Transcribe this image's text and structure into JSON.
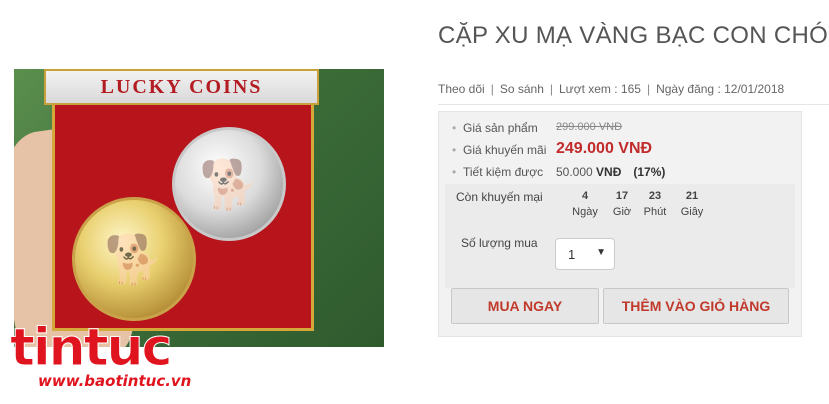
{
  "photo": {
    "lid_text": "LUCKY COINS"
  },
  "watermark": {
    "logo": "tintuc",
    "url": "www.baotintuc.vn"
  },
  "product": {
    "title": "CẶP XU MẠ VÀNG BẠC CON CHÓ V",
    "meta": {
      "follow": "Theo dõi",
      "compare": "So sánh",
      "views": "Lượt xem : 165",
      "posted": "Ngày đăng : 12/01/2018"
    }
  },
  "pricing": {
    "original_label": "Giá sản phẩm",
    "original_value": "299.000 VNĐ",
    "sale_label": "Giá khuyến mãi",
    "sale_value": "249.000 VNĐ",
    "save_label": "Tiết kiệm được",
    "save_amount": "50.000",
    "save_currency": "VNĐ",
    "save_percent": "(17%)"
  },
  "countdown": {
    "label": "Còn khuyến mại",
    "units": [
      {
        "value": "4",
        "unit": "Ngày"
      },
      {
        "value": "17",
        "unit": "Giờ"
      },
      {
        "value": "23",
        "unit": "Phút"
      },
      {
        "value": "21",
        "unit": "Giây"
      }
    ]
  },
  "quantity": {
    "label": "Số lượng mua",
    "value": "1"
  },
  "buttons": {
    "buy": "MUA NGAY",
    "cart": "THÊM VÀO GIỎ HÀNG"
  },
  "colors": {
    "sale_red": "#c12b2b",
    "button_text": "#c0392b",
    "watermark_red": "#e0141f"
  }
}
